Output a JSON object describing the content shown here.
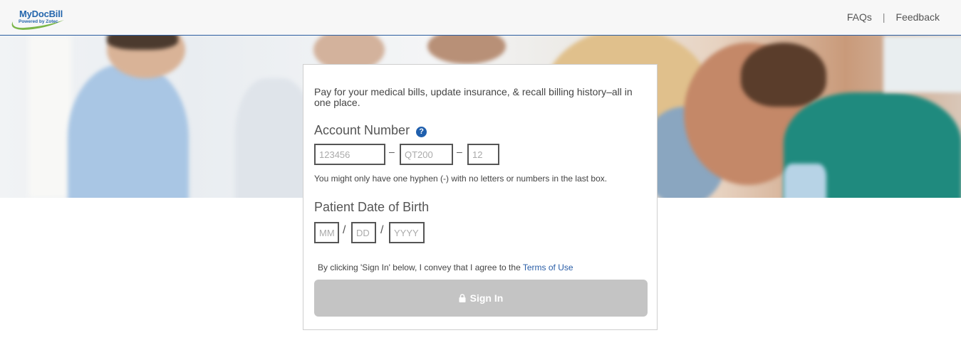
{
  "header": {
    "logo_text": "MyDocBill",
    "logo_subtext": "Powered by Zotec",
    "nav": {
      "faqs": "FAQs",
      "separator": "|",
      "feedback": "Feedback"
    }
  },
  "card": {
    "intro": "Pay for your medical bills, update insurance, & recall billing history–all in one place.",
    "account": {
      "label": "Account Number",
      "help_icon": "question-circle-icon",
      "field1_placeholder": "123456",
      "field2_placeholder": "QT200",
      "field3_placeholder": "12",
      "dash": "–",
      "hint": "You might only have one hyphen (-) with no letters or numbers in the last box."
    },
    "dob": {
      "label": "Patient Date of Birth",
      "mm_placeholder": "MM",
      "dd_placeholder": "DD",
      "yyyy_placeholder": "YYYY",
      "slash": "/"
    },
    "terms_prefix": "By clicking 'Sign In' below, I convey that I agree to the ",
    "terms_link": "Terms of Use",
    "signin_label": "Sign In",
    "signin_icon": "lock-icon"
  },
  "colors": {
    "brand_blue": "#2466ad",
    "header_border": "#2c5ea0",
    "signin_disabled": "#c4c4c4",
    "link": "#2a5ea7"
  }
}
